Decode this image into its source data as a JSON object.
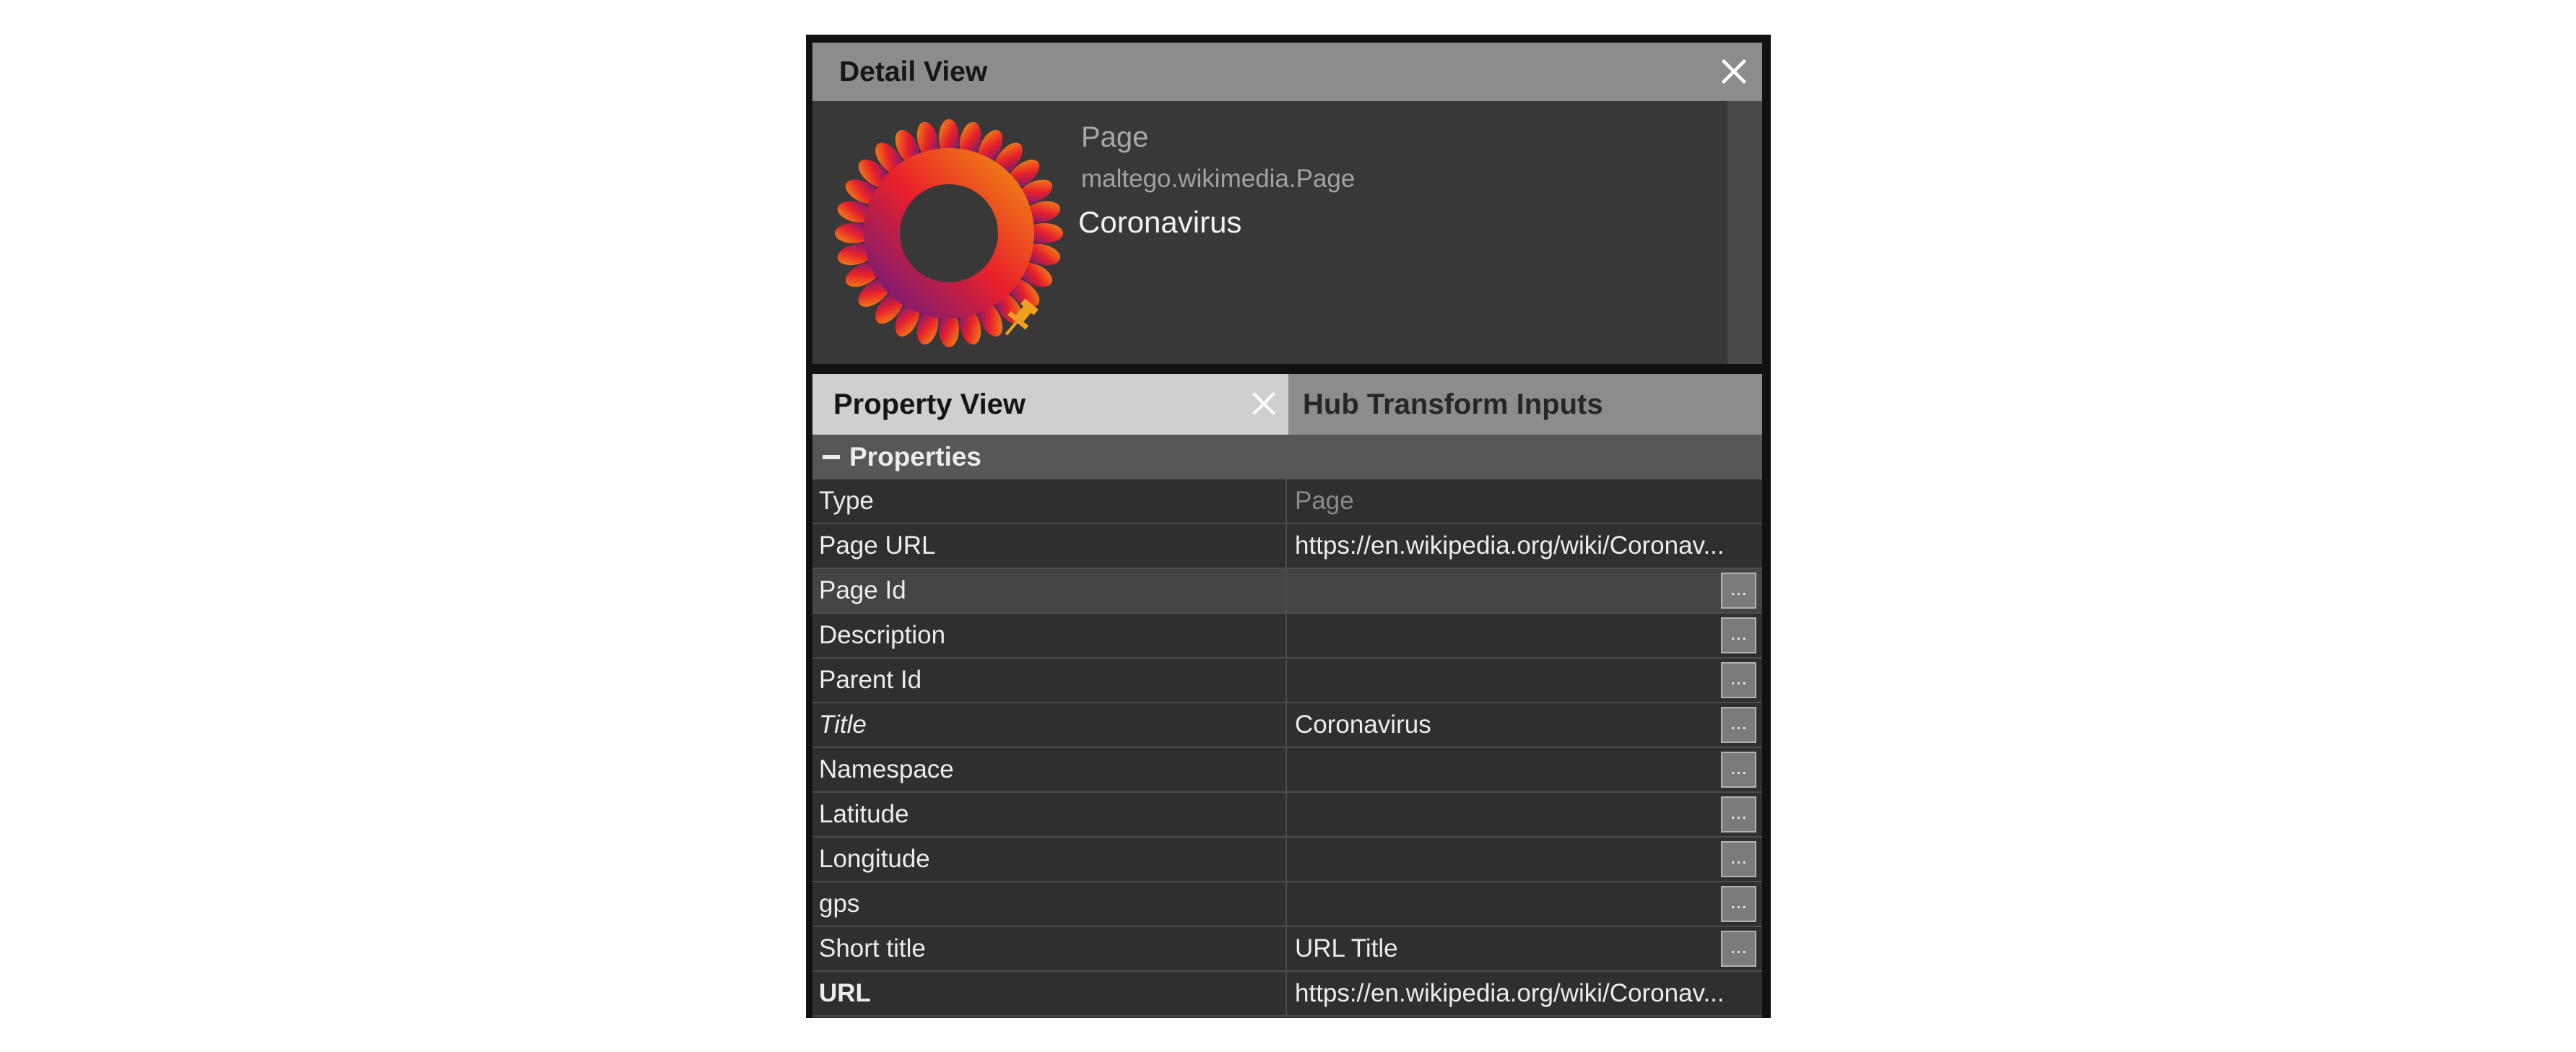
{
  "detail_view": {
    "title": "Detail View",
    "entity_type": "Page",
    "entity_type_id": "maltego.wikimedia.Page",
    "entity_value": "Coronavirus",
    "icon": "wikimedia-flower-icon",
    "pin_icon": "pin-icon"
  },
  "tabs": [
    {
      "label": "Property View",
      "active": true
    },
    {
      "label": "Hub Transform Inputs",
      "active": false
    }
  ],
  "section": {
    "label": "Properties",
    "toggle": "collapse"
  },
  "properties": [
    {
      "name": "Type",
      "value": "Page",
      "style": "normal",
      "value_style": "muted",
      "button": false
    },
    {
      "name": "Page URL",
      "value": "https://en.wikipedia.org/wiki/Coronav...",
      "style": "normal",
      "button": false
    },
    {
      "name": "Page Id",
      "value": "",
      "style": "normal",
      "button": true,
      "selected": true
    },
    {
      "name": "Description",
      "value": "",
      "style": "normal",
      "button": true
    },
    {
      "name": "Parent Id",
      "value": "",
      "style": "normal",
      "button": true
    },
    {
      "name": "Title",
      "value": "Coronavirus",
      "style": "italic",
      "button": true
    },
    {
      "name": "Namespace",
      "value": "",
      "style": "normal",
      "button": true
    },
    {
      "name": "Latitude",
      "value": "",
      "style": "normal",
      "button": true
    },
    {
      "name": "Longitude",
      "value": "",
      "style": "normal",
      "button": true
    },
    {
      "name": "gps",
      "value": "",
      "style": "normal",
      "button": true
    },
    {
      "name": "Short title",
      "value": "URL Title",
      "style": "normal",
      "button": true
    },
    {
      "name": "URL",
      "value": "https://en.wikipedia.org/wiki/Coronav...",
      "style": "bold",
      "button": false
    }
  ],
  "edit_button_label": "...",
  "colors": {
    "header_bg": "#8c8c8c",
    "panel_bg": "#393839",
    "grid_bg": "#302e2f",
    "active_tab_bg": "#cfcfcf",
    "pin": "#f0a020"
  }
}
